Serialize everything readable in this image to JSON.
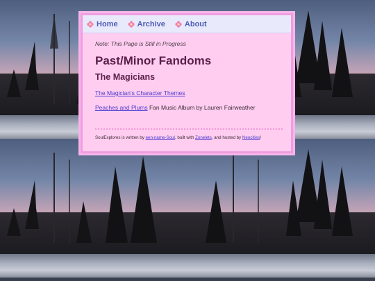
{
  "nav": {
    "items": [
      {
        "label": "Home",
        "icon": "flower-icon"
      },
      {
        "label": "Archive",
        "icon": "flower-icon"
      },
      {
        "label": "About",
        "icon": "flower-icon"
      }
    ],
    "icon_color": "#f27fb8"
  },
  "main": {
    "note": "Note: This Page is Still in Progress",
    "title": "Past/Minor Fandoms",
    "section_title": "The Magicians",
    "links": [
      {
        "link_text": "The Magician's Character Themes",
        "suffix": ""
      },
      {
        "link_text": "Peaches and Plums",
        "suffix": " Fan Music Album by Lauren Fairweather"
      }
    ]
  },
  "footer": {
    "prefix": "SoulExplores is written by ",
    "author": "een-name-Soul",
    "middle": ", built with ",
    "tool": "Zonelets",
    "middle2": ", and hosted by ",
    "host": "Neocities",
    "end": "!"
  },
  "colors": {
    "content_bg": "#ffcdf0",
    "border": "#f09ee0",
    "nav_bg": "#e8e9fb",
    "nav_text": "#4f5fb4",
    "heading": "#5a1f48",
    "link": "#4c3bd0"
  }
}
